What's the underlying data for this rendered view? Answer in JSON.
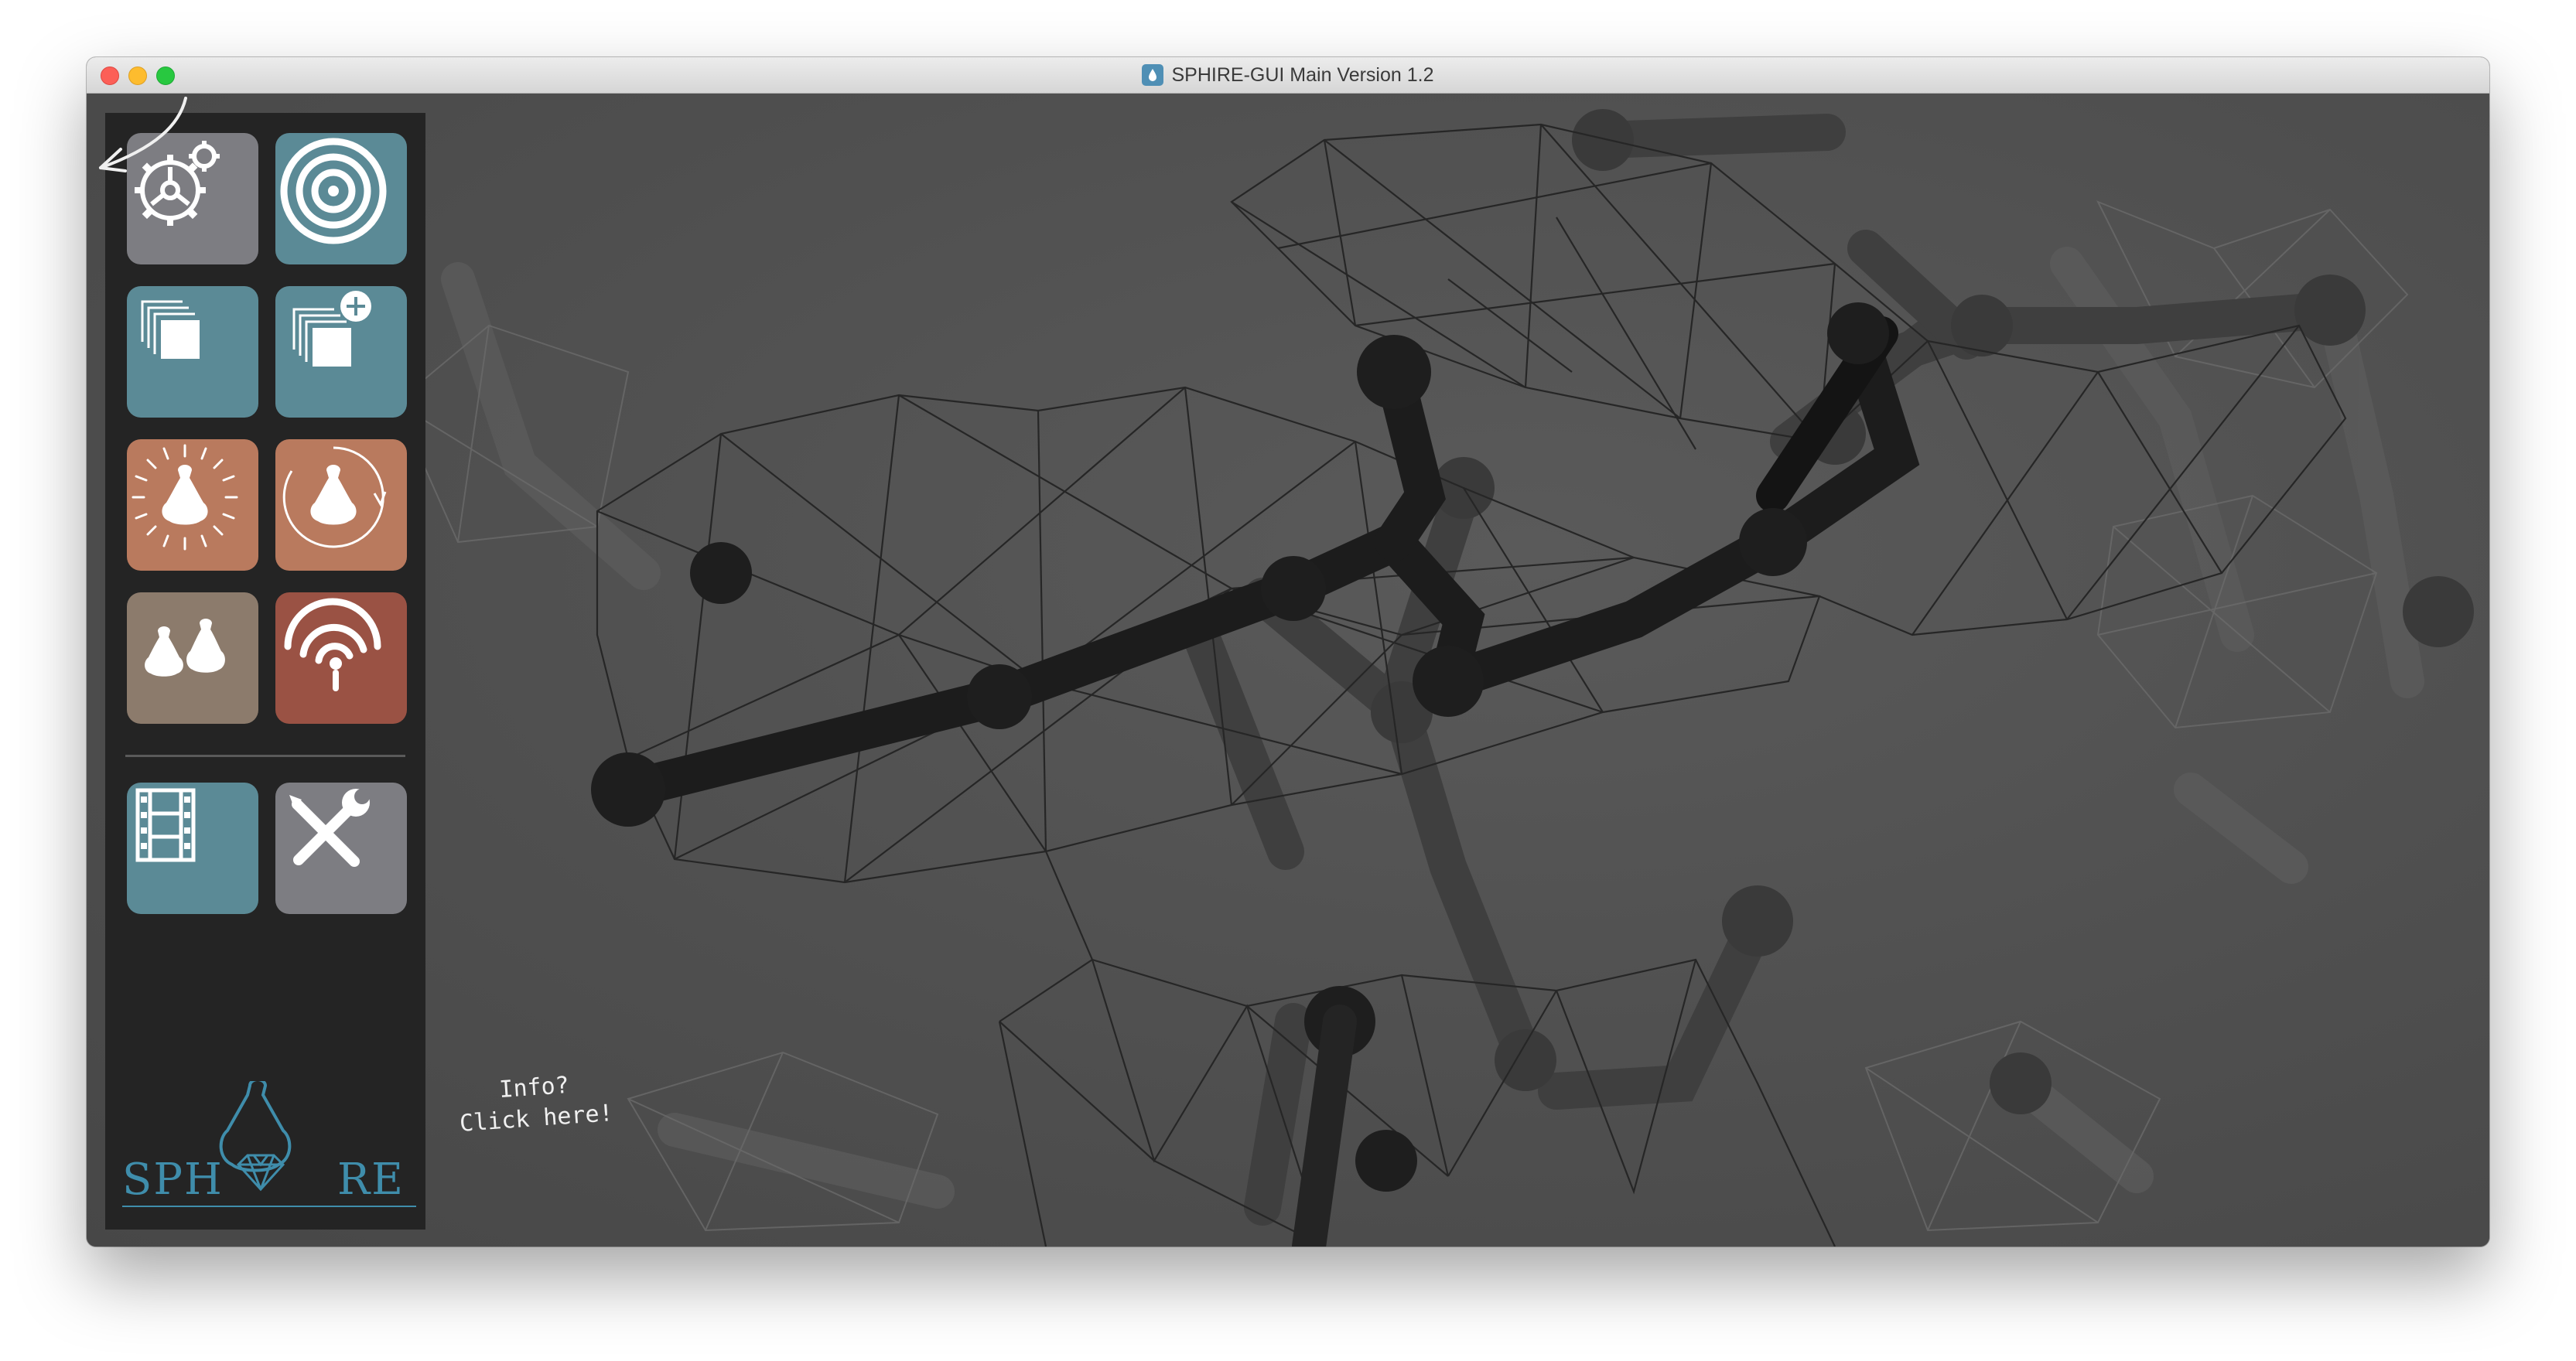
{
  "window": {
    "title": "SPHIRE-GUI Main Version 1.2",
    "controls": [
      "close",
      "minimize",
      "maximize"
    ]
  },
  "sidebar": {
    "tiles": [
      {
        "name": "settings-gears",
        "icon": "gears-icon",
        "color": "#7d7d82"
      },
      {
        "name": "target",
        "icon": "target-icon",
        "color": "#5b8a96"
      },
      {
        "name": "stack",
        "icon": "stack-icon",
        "color": "#5b8a96"
      },
      {
        "name": "stack-add",
        "icon": "stack-add-icon",
        "color": "#5b8a96"
      },
      {
        "name": "molecule-burst",
        "icon": "molecule-burst-icon",
        "color": "#b97a5e"
      },
      {
        "name": "molecule-rotate",
        "icon": "molecule-rotate-icon",
        "color": "#b97a5e"
      },
      {
        "name": "molecule-pair",
        "icon": "molecule-pair-icon",
        "color": "#8c7b6c"
      },
      {
        "name": "signal",
        "icon": "signal-icon",
        "color": "#9a5244"
      },
      {
        "name": "film",
        "icon": "film-icon",
        "color": "#5b8a96"
      },
      {
        "name": "tools",
        "icon": "tools-icon",
        "color": "#7d7d82"
      }
    ]
  },
  "logo": {
    "left": "SPH",
    "right": "RE"
  },
  "info_note": {
    "line1": "Info?",
    "line2": "Click here!"
  }
}
